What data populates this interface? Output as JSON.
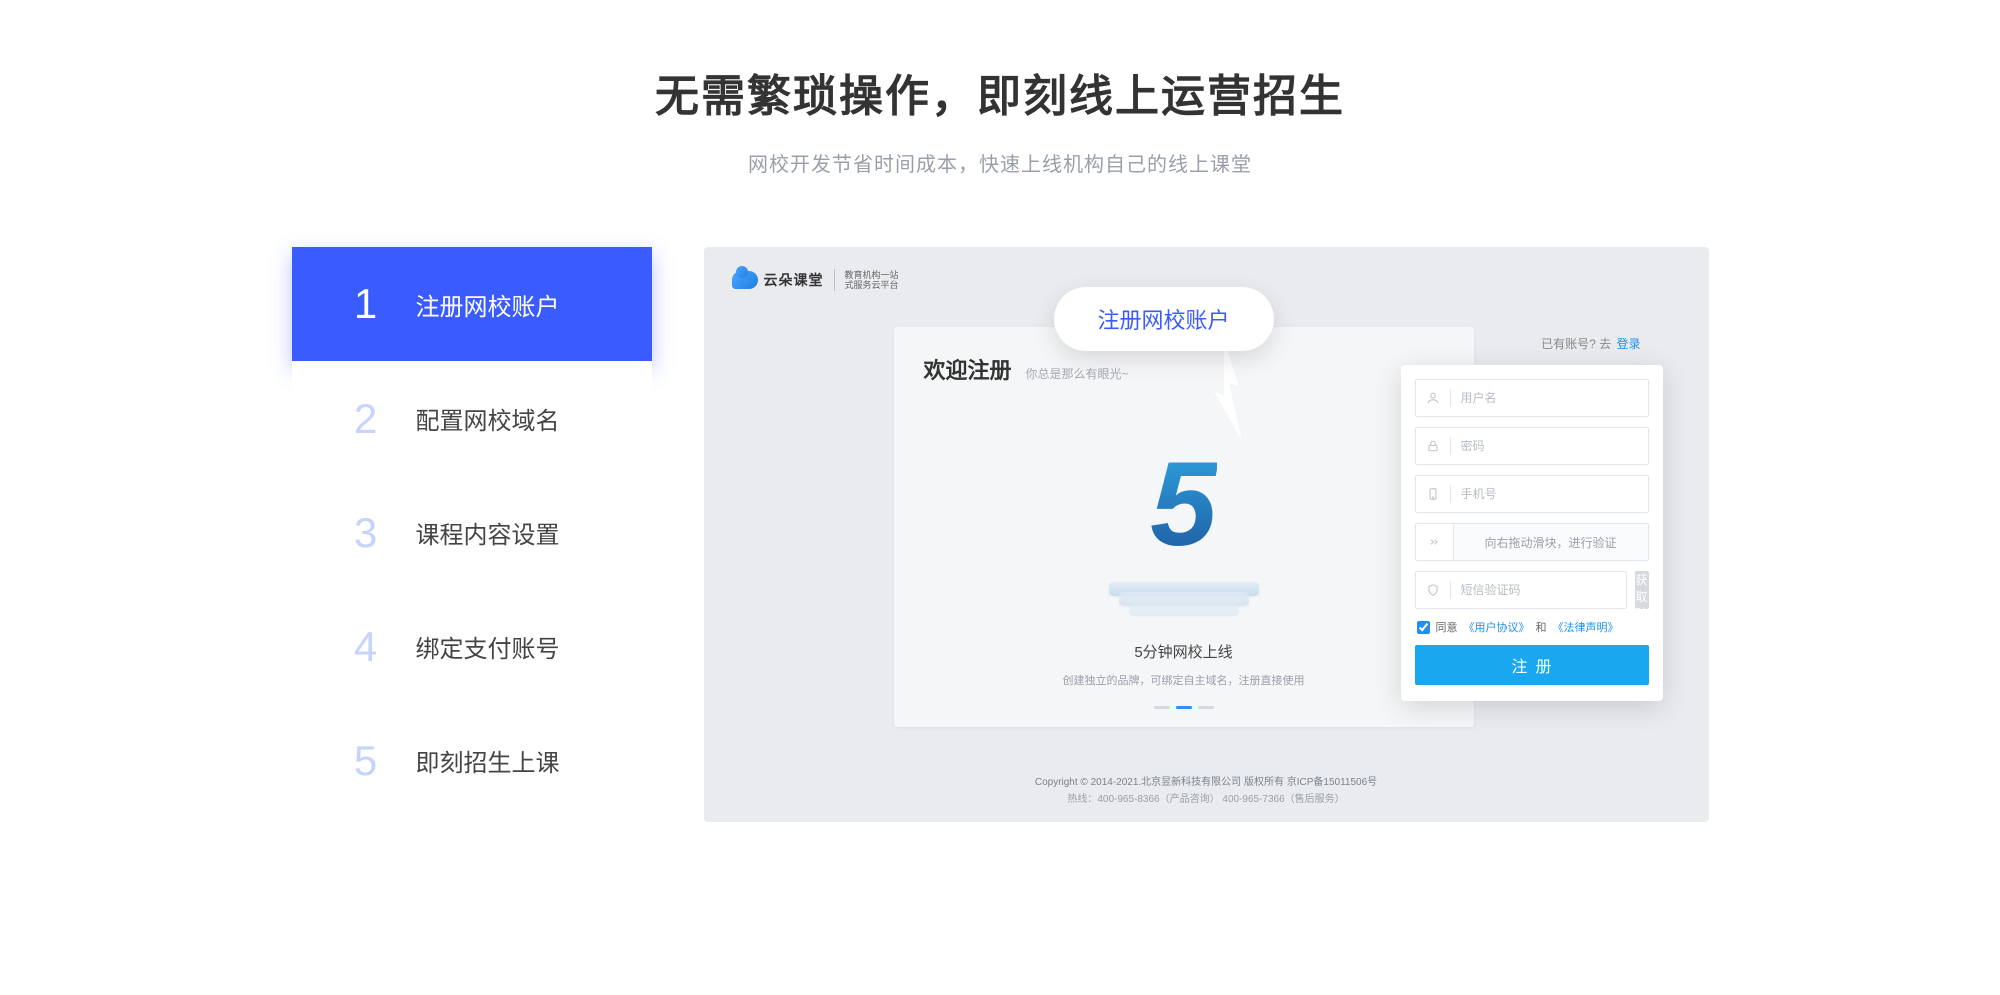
{
  "headline": "无需繁琐操作，即刻线上运营招生",
  "sub_headline": "网校开发节省时间成本，快速上线机构自己的线上课堂",
  "steps": [
    {
      "num": "1",
      "label": "注册网校账户",
      "active": true
    },
    {
      "num": "2",
      "label": "配置网校域名",
      "active": false
    },
    {
      "num": "3",
      "label": "课程内容设置",
      "active": false
    },
    {
      "num": "4",
      "label": "绑定支付账号",
      "active": false
    },
    {
      "num": "5",
      "label": "即刻招生上课",
      "active": false
    }
  ],
  "preview": {
    "logo_text": "云朵课堂",
    "logo_sub_line1": "教育机构一站",
    "logo_sub_line2": "式服务云平台",
    "callout": "注册网校账户",
    "have_account_prefix": "已有账号? 去",
    "have_account_link": "登录",
    "welcome": {
      "title": "欢迎注册",
      "hint": "你总是那么有眼光~",
      "caption": "5分钟网校上线",
      "desc": "创建独立的品牌，可绑定自主域名，注册直接使用"
    },
    "form": {
      "username_placeholder": "用户名",
      "password_placeholder": "密码",
      "phone_placeholder": "手机号",
      "slider_text": "向右拖动滑块，进行验证",
      "code_placeholder": "短信验证码",
      "code_button": "获取验证码",
      "agree_prefix": "同意",
      "agree_link1": "《用户协议》",
      "agree_mid": "和",
      "agree_link2": "《法律声明》",
      "submit": "注册"
    },
    "footer_line1": "Copyright © 2014-2021.北京昱新科技有限公司 版权所有  京ICP备15011506号",
    "footer_line2": "热线：400-965-8366（产品咨询） 400-965-7366（售后服务）"
  }
}
